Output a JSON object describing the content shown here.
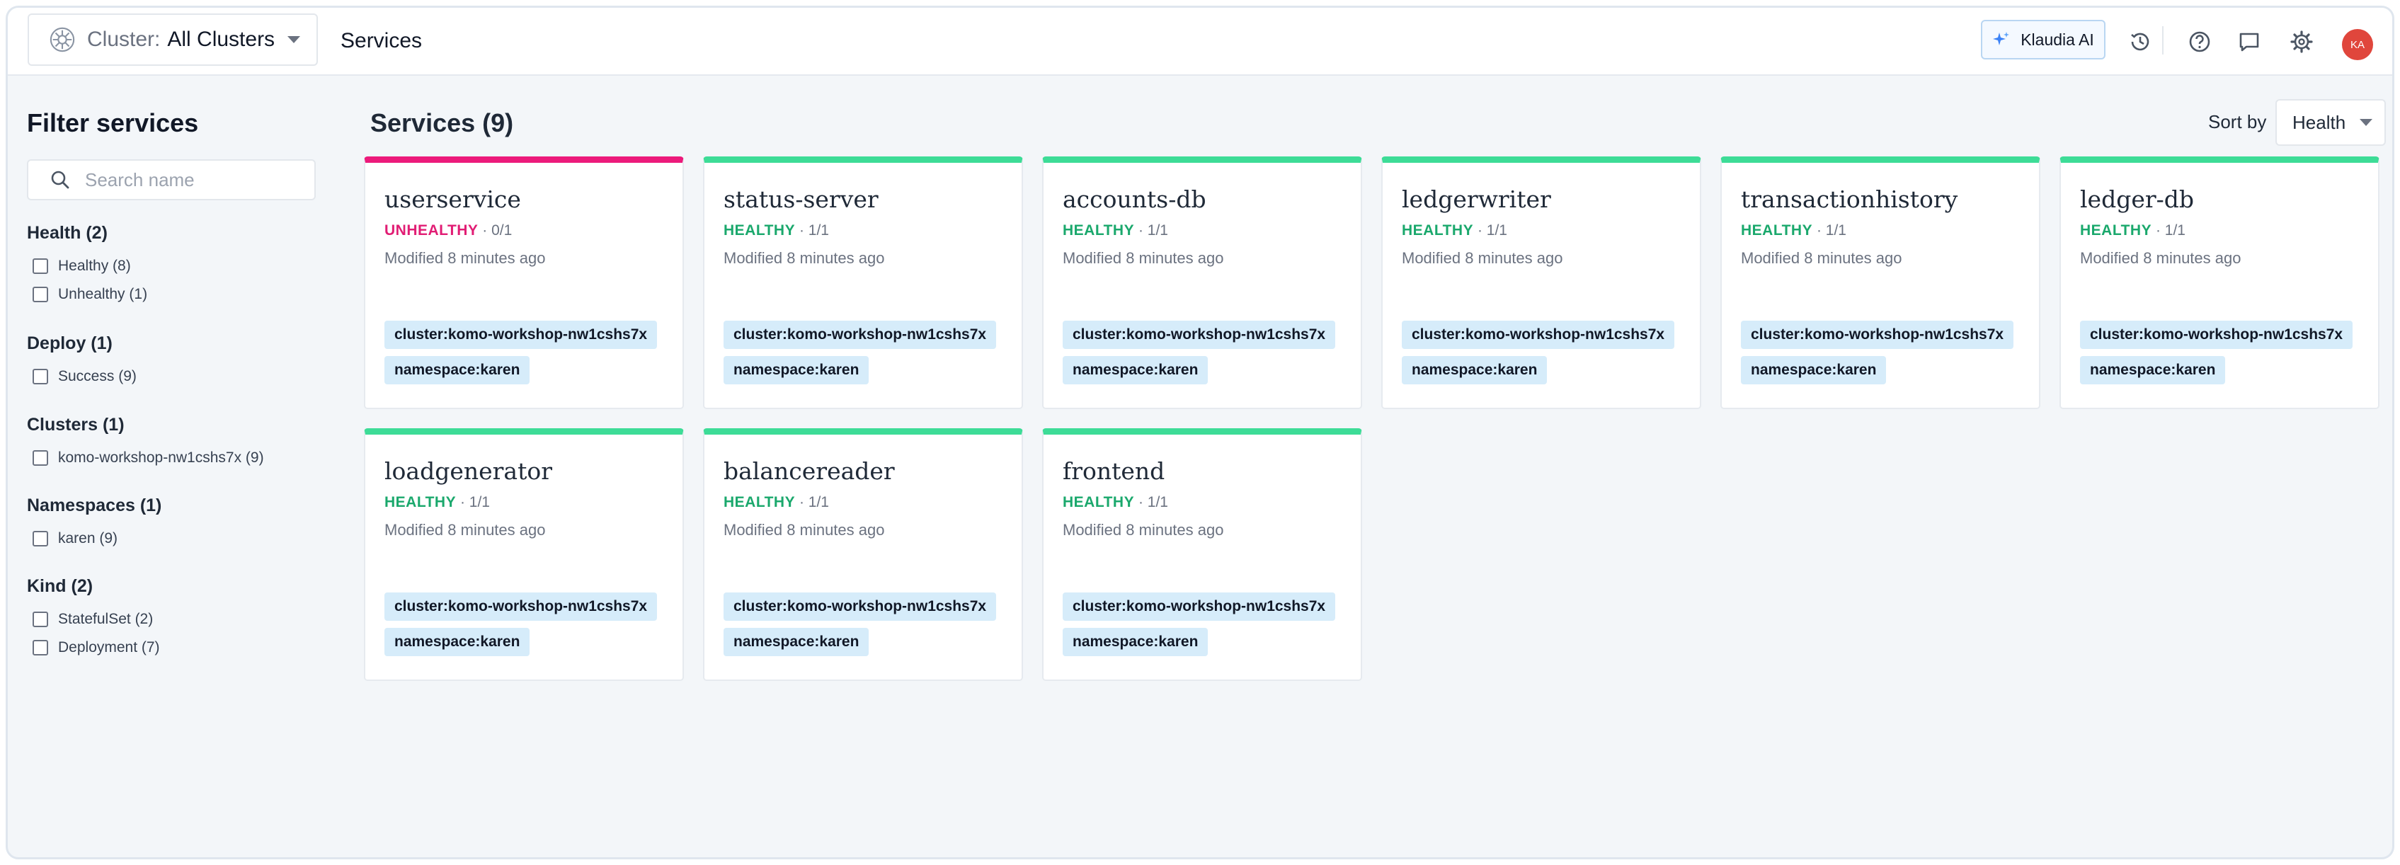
{
  "topbar": {
    "cluster_label": "Cluster:",
    "cluster_value": "All Clusters",
    "page_title": "Services",
    "klaudia_label": "Klaudia AI",
    "avatar_initials": "KA",
    "icons": [
      "kubernetes-icon",
      "chevron-down-icon",
      "sparkle-icon",
      "history-icon",
      "help-icon",
      "chat-icon",
      "gear-icon"
    ]
  },
  "sidebar": {
    "title": "Filter services",
    "search_placeholder": "Search name",
    "groups": [
      {
        "title": "Health (2)",
        "options": [
          "Healthy (8)",
          "Unhealthy (1)"
        ]
      },
      {
        "title": "Deploy (1)",
        "options": [
          "Success (9)"
        ]
      },
      {
        "title": "Clusters (1)",
        "options": [
          "komo-workshop-nw1cshs7x (9)"
        ]
      },
      {
        "title": "Namespaces (1)",
        "options": [
          "karen (9)"
        ]
      },
      {
        "title": "Kind (2)",
        "options": [
          "StatefulSet (2)",
          "Deployment (7)"
        ]
      }
    ]
  },
  "main": {
    "title": "Services (9)",
    "sort_label": "Sort by",
    "sort_value": "Health",
    "colors": {
      "healthy": "#3ddc97",
      "unhealthy": "#ec1a7b",
      "tag_bg": "#d6ecfa"
    },
    "services": [
      {
        "name": "userservice",
        "status": "UNHEALTHY",
        "replicas": "0/1",
        "modified": "Modified 8 minutes ago",
        "tags": [
          "cluster:komo-workshop-nw1cshs7x",
          "namespace:karen"
        ]
      },
      {
        "name": "status-server",
        "status": "HEALTHY",
        "replicas": "1/1",
        "modified": "Modified 8 minutes ago",
        "tags": [
          "cluster:komo-workshop-nw1cshs7x",
          "namespace:karen"
        ]
      },
      {
        "name": "accounts-db",
        "status": "HEALTHY",
        "replicas": "1/1",
        "modified": "Modified 8 minutes ago",
        "tags": [
          "cluster:komo-workshop-nw1cshs7x",
          "namespace:karen"
        ]
      },
      {
        "name": "ledgerwriter",
        "status": "HEALTHY",
        "replicas": "1/1",
        "modified": "Modified 8 minutes ago",
        "tags": [
          "cluster:komo-workshop-nw1cshs7x",
          "namespace:karen"
        ]
      },
      {
        "name": "transactionhistory",
        "status": "HEALTHY",
        "replicas": "1/1",
        "modified": "Modified 8 minutes ago",
        "tags": [
          "cluster:komo-workshop-nw1cshs7x",
          "namespace:karen"
        ]
      },
      {
        "name": "ledger-db",
        "status": "HEALTHY",
        "replicas": "1/1",
        "modified": "Modified 8 minutes ago",
        "tags": [
          "cluster:komo-workshop-nw1cshs7x",
          "namespace:karen"
        ]
      },
      {
        "name": "loadgenerator",
        "status": "HEALTHY",
        "replicas": "1/1",
        "modified": "Modified 8 minutes ago",
        "tags": [
          "cluster:komo-workshop-nw1cshs7x",
          "namespace:karen"
        ]
      },
      {
        "name": "balancereader",
        "status": "HEALTHY",
        "replicas": "1/1",
        "modified": "Modified 8 minutes ago",
        "tags": [
          "cluster:komo-workshop-nw1cshs7x",
          "namespace:karen"
        ]
      },
      {
        "name": "frontend",
        "status": "HEALTHY",
        "replicas": "1/1",
        "modified": "Modified 8 minutes ago",
        "tags": [
          "cluster:komo-workshop-nw1cshs7x",
          "namespace:karen"
        ]
      }
    ]
  }
}
